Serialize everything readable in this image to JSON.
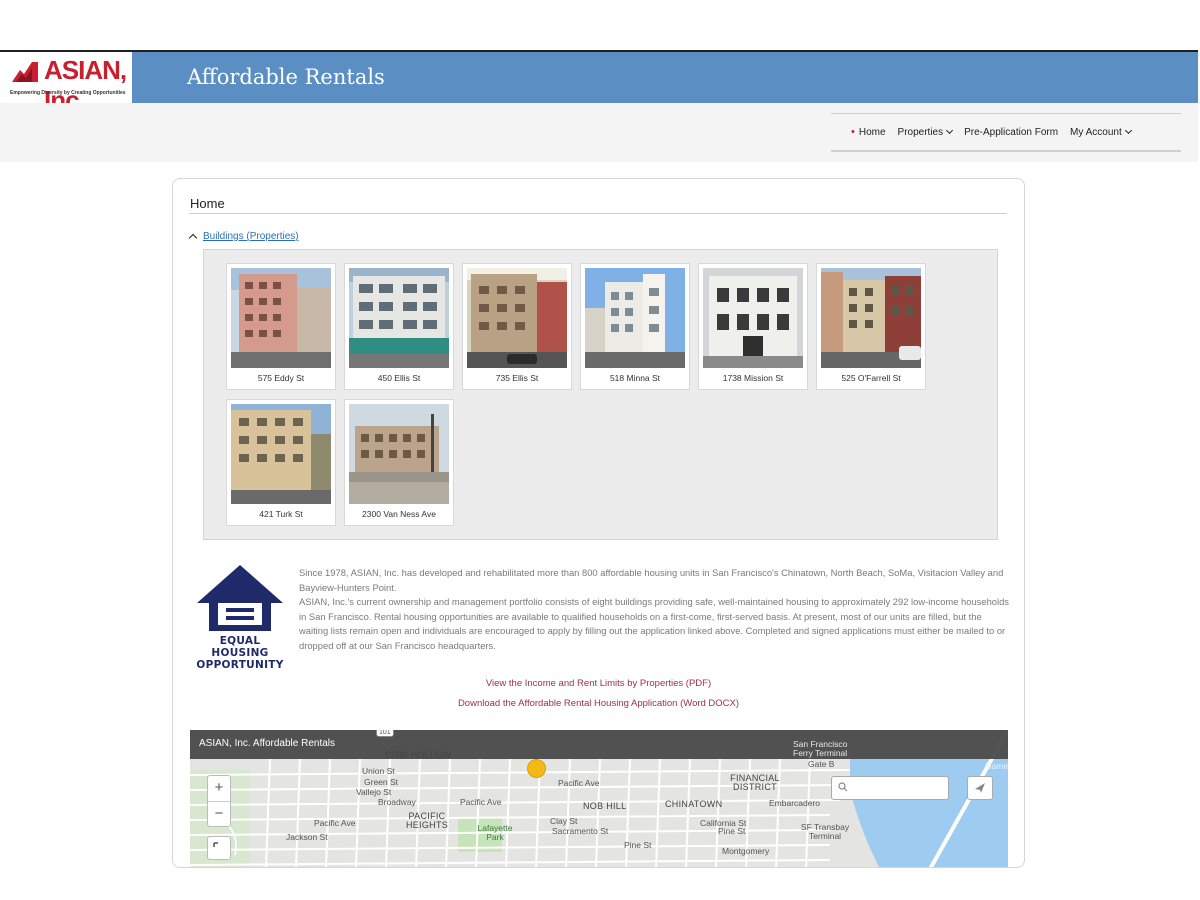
{
  "brand": {
    "logo_text": "ASIAN, Inc.",
    "tagline": "Empowering Diversity by Creating Opportunities",
    "site_title": "Affordable Rentals",
    "brand_color": "#c8202f",
    "header_color": "#5b8fc4"
  },
  "nav": {
    "items": [
      {
        "label": "Home",
        "active": true
      },
      {
        "label": "Properties",
        "dropdown": true
      },
      {
        "label": "Pre-Application Form"
      },
      {
        "label": "My Account",
        "dropdown": true
      }
    ]
  },
  "page": {
    "title": "Home",
    "section_toggle": "Buildings (Properties)"
  },
  "properties": [
    {
      "name": "575 Eddy St"
    },
    {
      "name": "450 Ellis St"
    },
    {
      "name": "735 Ellis St"
    },
    {
      "name": "518 Minna St"
    },
    {
      "name": "1738 Mission St"
    },
    {
      "name": "525 O'Farrell St"
    },
    {
      "name": "421 Turk St"
    },
    {
      "name": "2300 Van Ness Ave"
    }
  ],
  "eho": {
    "line1": "EQUAL HOUSING",
    "line2": "OPPORTUNITY"
  },
  "about": {
    "p1": "Since 1978, ASIAN, Inc. has developed and rehabilitated more than 800 affordable housing units in San Francisco's Chinatown, North Beach, SoMa, Visitacion Valley and Bayview-Hunters Point.",
    "p2": "ASIAN, Inc.'s current ownership and management portfolio consists of eight buildings providing safe, well-maintained housing to approximately 292 low-income households in San Francisco. Rental housing opportunities are available to qualified households on a first-come, first-served basis. At present, most of our units are filled, but the waiting lists remain open and individuals are encouraged to apply by filling out the application linked above. Completed and signed applications must either be mailed to or dropped off at our San Francisco headquarters."
  },
  "links": {
    "income_limits": "View the Income and Rent Limits by Properties (PDF)",
    "application": "Download the Affordable Rental Housing Application (Word DOCX)"
  },
  "map": {
    "title": "ASIAN, Inc. Affordable Rentals",
    "zoom_in": "+",
    "zoom_out": "−",
    "labels": {
      "cow_hollow": "COW HOLLOW",
      "pacific_heights": "PACIFIC HEIGHTS",
      "nob_hill": "NOB HILL",
      "chinatown": "CHINATOWN",
      "financial": "FINANCIAL DISTRICT",
      "lafayette": "Lafayette Park",
      "ferry": "San Francisco Ferry Terminal",
      "gate_b": "Gate B",
      "embarcadero": "Embarcadero",
      "transbay": "SF Transbay Terminal",
      "union": "Union St",
      "green": "Green St",
      "vallejo": "Vallejo St",
      "broadway": "Broadway",
      "pacific_ave": "Pacific Ave",
      "jackson": "Jackson St",
      "clay": "Clay St",
      "sacramento": "Sacramento St",
      "california": "California St",
      "pine": "Pine St",
      "montgomery": "Montgomery",
      "hwy": "101",
      "alameda": "Alame"
    }
  }
}
